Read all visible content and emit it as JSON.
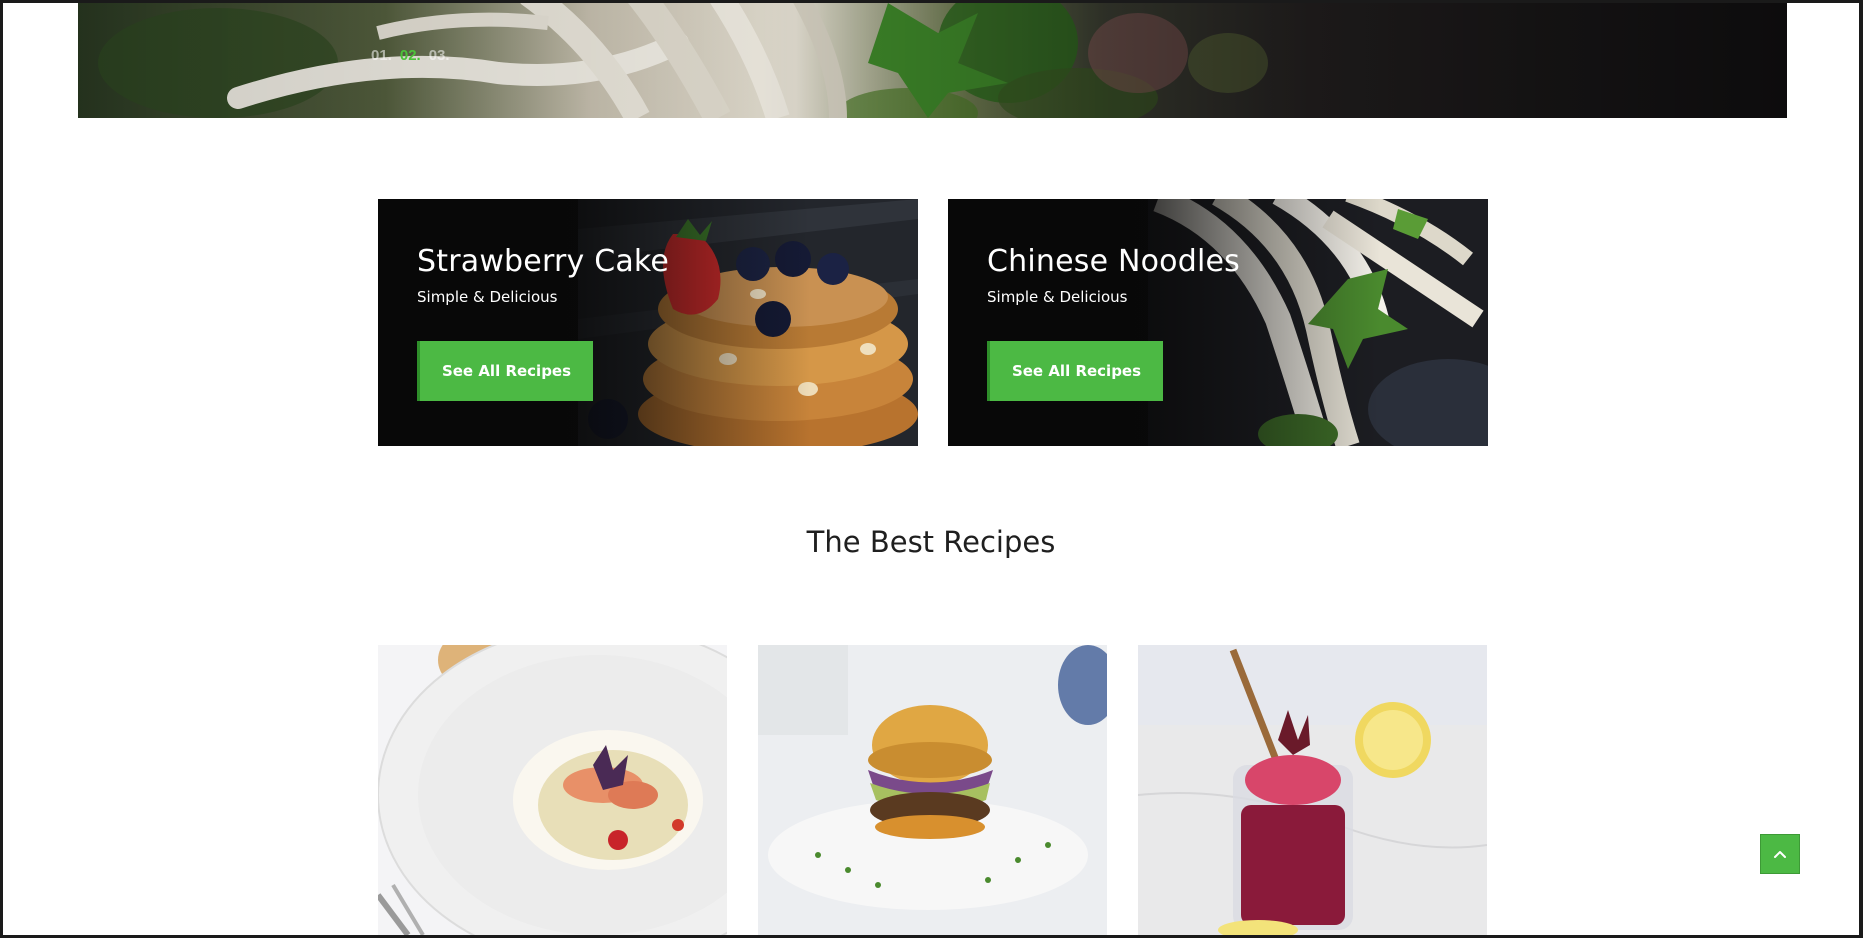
{
  "hero": {
    "slides": [
      "01.",
      "02.",
      "03."
    ],
    "active_slide": 1
  },
  "promos": [
    {
      "title": "Strawberry Cake",
      "subtitle": "Simple & Delicious",
      "button": "See All Recipes"
    },
    {
      "title": "Chinese Noodles",
      "subtitle": "Simple & Delicious",
      "button": "See All Recipes"
    }
  ],
  "section": {
    "title": "The Best Recipes"
  },
  "recipes": [
    {
      "image": "seafood-plate"
    },
    {
      "image": "burger"
    },
    {
      "image": "berry-drink"
    }
  ],
  "colors": {
    "accent": "#4cb944",
    "accent_dark": "#2e8f2a",
    "heading": "#1f1f1f"
  },
  "icons": {
    "back_to_top": "chevron-up-icon"
  }
}
